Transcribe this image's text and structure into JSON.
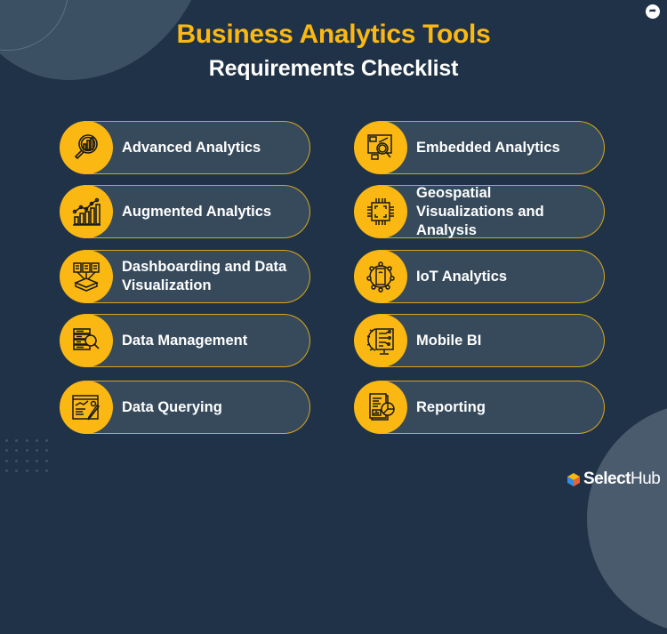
{
  "header": {
    "title": "Business Analytics Tools",
    "subtitle": "Requirements Checklist"
  },
  "share_icon": "share-icon",
  "colors": {
    "background": "#1f3247",
    "accent": "#fbb812",
    "pill_fill": "#364a5c",
    "pill_border": "#d9a51c",
    "text": "#ffffff"
  },
  "checklist": {
    "left": [
      {
        "label": "Advanced Analytics",
        "icon": "magnifier-chart-icon"
      },
      {
        "label": "Augmented Analytics",
        "icon": "growth-bar-chart-icon"
      },
      {
        "label": "Dashboarding and Data Visualization",
        "icon": "documents-to-box-icon"
      },
      {
        "label": "Data Management",
        "icon": "database-search-icon"
      },
      {
        "label": "Data Querying",
        "icon": "query-dashboard-pen-icon"
      }
    ],
    "right": [
      {
        "label": "Embedded Analytics",
        "icon": "embedded-search-screen-icon"
      },
      {
        "label": "Geospatial Visualizations and Analysis",
        "icon": "chip-icon"
      },
      {
        "label": "IoT Analytics",
        "icon": "iot-network-phone-icon"
      },
      {
        "label": "Mobile BI",
        "icon": "monitor-gear-circuit-icon"
      },
      {
        "label": "Reporting",
        "icon": "report-pie-chart-icon"
      }
    ]
  },
  "brand": {
    "name_bold": "Select",
    "name_light": "Hub"
  }
}
